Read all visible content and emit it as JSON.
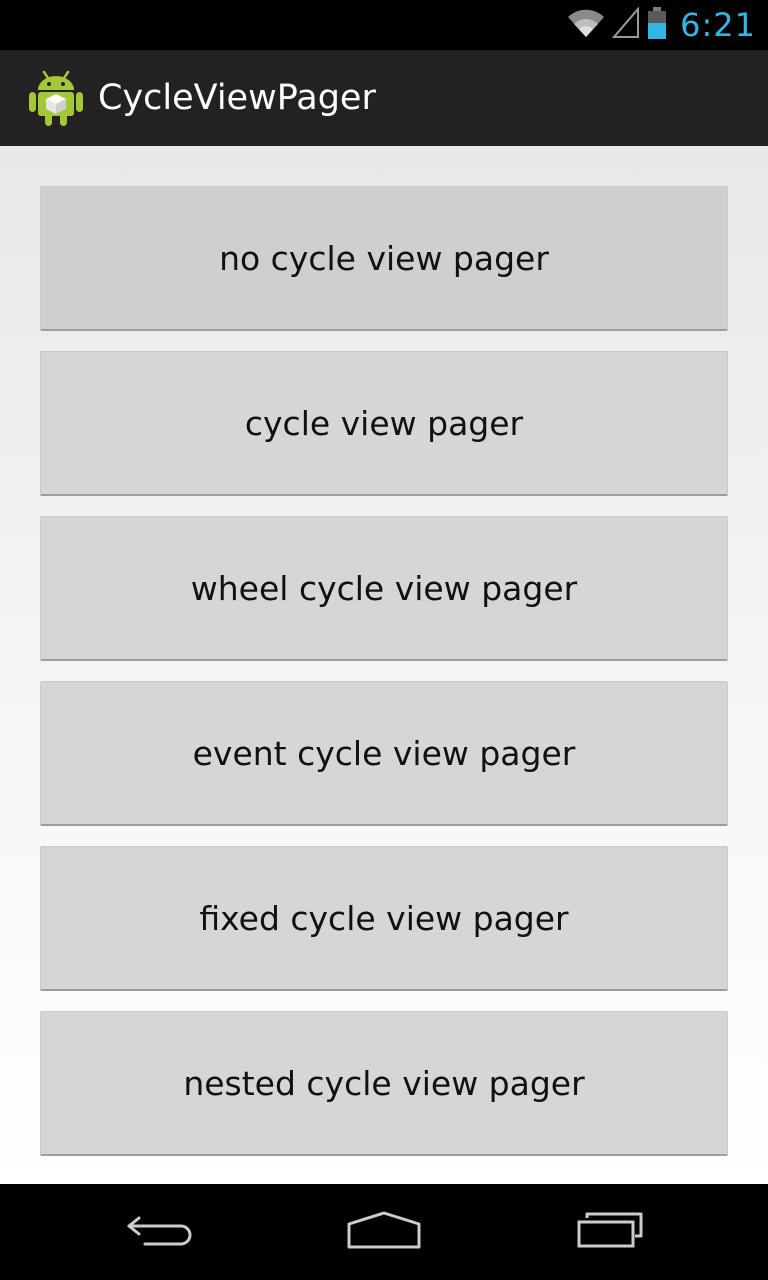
{
  "status_bar": {
    "time": "6:21",
    "time_color": "#33b5e5",
    "icons": [
      "wifi-icon",
      "cell-signal-icon",
      "battery-icon"
    ]
  },
  "action_bar": {
    "title": "CycleViewPager",
    "icon": "android-app-icon",
    "background": "#222222"
  },
  "buttons": [
    {
      "label": "no cycle view pager"
    },
    {
      "label": "cycle view pager"
    },
    {
      "label": "wheel cycle view pager"
    },
    {
      "label": "event cycle view pager"
    },
    {
      "label": "fixed cycle view pager"
    },
    {
      "label": "nested cycle view pager"
    }
  ],
  "nav_bar": {
    "items": [
      "back-icon",
      "home-icon",
      "recents-icon"
    ]
  }
}
